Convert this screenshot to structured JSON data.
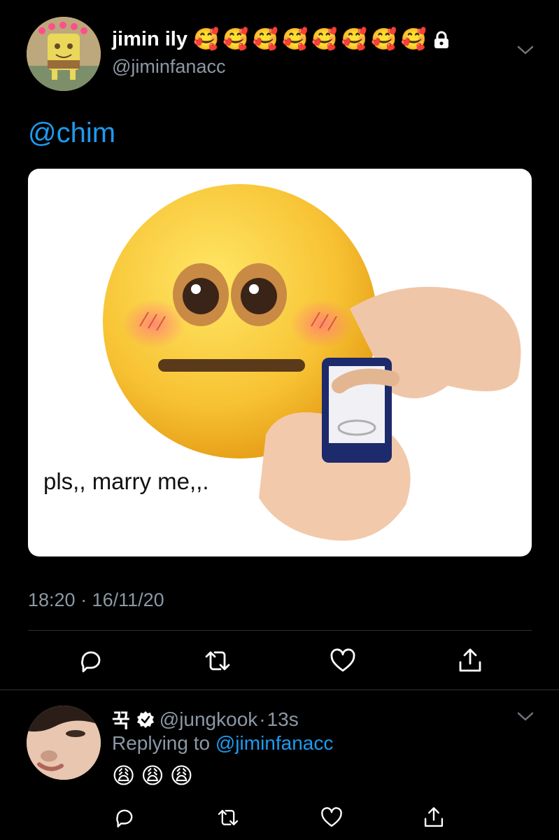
{
  "tweet": {
    "display_name": "jimin ily",
    "name_emojis": [
      "🥰",
      "🥰",
      "🥰",
      "🥰",
      "🥰",
      "🥰",
      "🥰",
      "🥰"
    ],
    "handle": "@jiminfanacc",
    "body_mention": "@chim",
    "media_caption": "pls,, marry me,,.",
    "timestamp": "18:20 · 16/11/20"
  },
  "reply": {
    "display_name": "꾹",
    "handle": "@jungkook",
    "separator": "·",
    "time": "13s",
    "replying_prefix": "Replying to ",
    "replying_handle": "@jiminfanacc",
    "emojis": [
      "😩",
      "😩",
      "😩"
    ]
  },
  "colors": {
    "accent": "#1d9bf0",
    "secondary_text": "#8b98a5",
    "background": "#000000"
  },
  "icons": [
    "lock-icon",
    "chevron-down-icon",
    "reply-icon",
    "retweet-icon",
    "like-icon",
    "share-icon",
    "verified-badge-icon"
  ]
}
